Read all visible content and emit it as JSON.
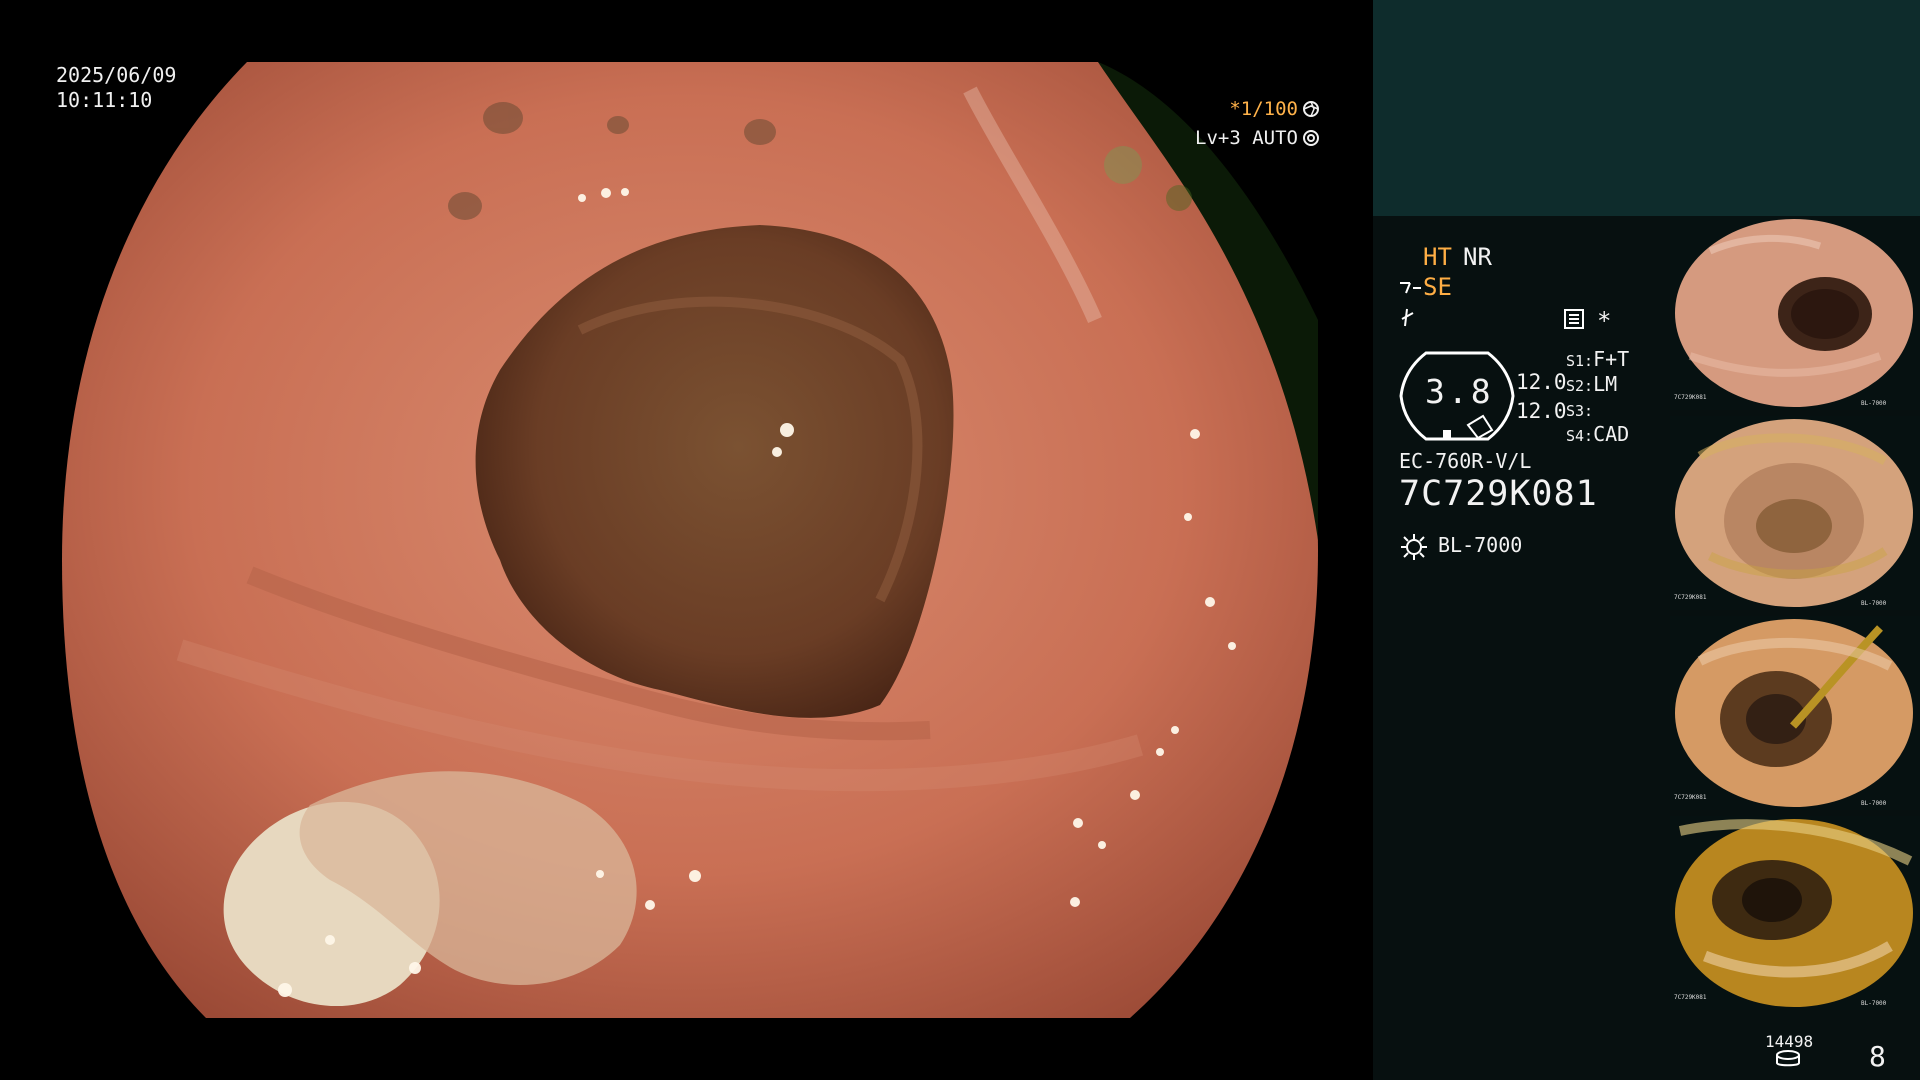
{
  "main": {
    "date": "2025/06/09",
    "time": "10:11:10",
    "shutter": "*1/100",
    "level": "Lv+3 AUTO"
  },
  "panel": {
    "ht": "HT",
    "nr": "NR",
    "se": "SE",
    "star": "*",
    "gauge_value": "3.8",
    "g1": "12.0",
    "g2": "12.0",
    "s1_label": "S1:",
    "s1_value": "F+T",
    "s2_label": "S2:",
    "s2_value": "LM",
    "s3_label": "S3:",
    "s3_value": "",
    "s4_label": "S4:",
    "s4_value": "CAD",
    "scope_model": "EC-760R-V/L",
    "scope_serial": "7C729K081",
    "light_source": "BL-7000",
    "image_count": "14498",
    "page_number": "8"
  },
  "colors": {
    "accent_orange": "#ffae45",
    "panel_top": "#0e2c2c",
    "panel_bg": "#071010",
    "tissue": "#c8735a"
  },
  "icons": {
    "shutter": "aperture-icon",
    "auto": "target-icon",
    "se": "structure-enhancement-icon",
    "fast": "lightning-icon",
    "menu": "menu-icon",
    "light": "sun-icon",
    "storage": "database-icon"
  },
  "thumbnails": [
    {
      "name": "thumbnail-1",
      "scope_serial": "7C729K081",
      "light_source": "BL-7000"
    },
    {
      "name": "thumbnail-2",
      "scope_serial": "7C729K081",
      "light_source": "BL-7000"
    },
    {
      "name": "thumbnail-3",
      "scope_serial": "7C729K081",
      "light_source": "BL-7000"
    },
    {
      "name": "thumbnail-4",
      "scope_serial": "7C729K081",
      "light_source": "BL-7000"
    }
  ]
}
